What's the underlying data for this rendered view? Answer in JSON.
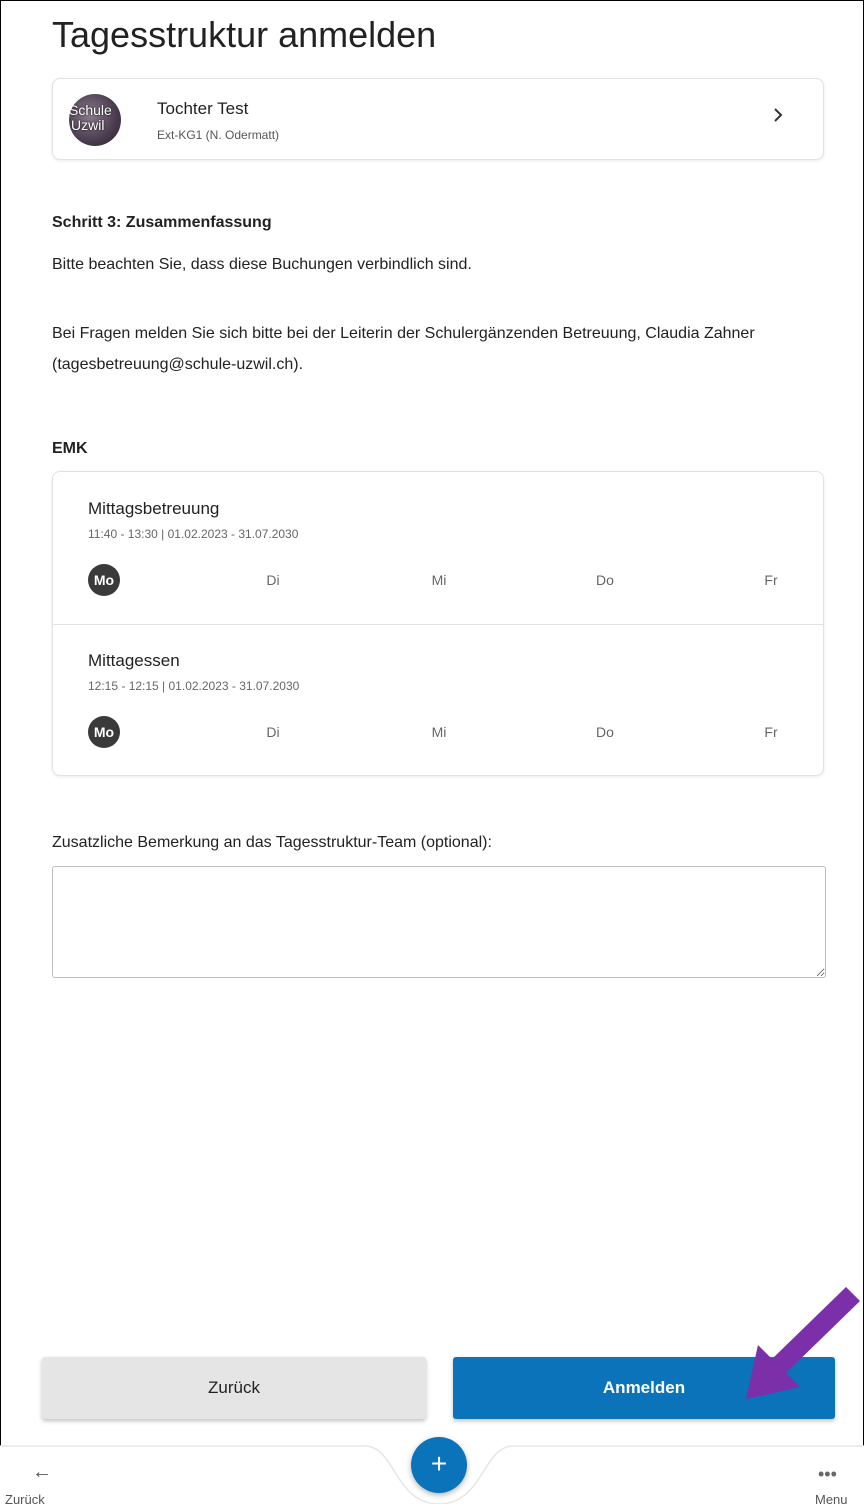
{
  "page": {
    "title": "Tagesstruktur anmelden"
  },
  "child": {
    "avatar_text_line1": "Schule",
    "avatar_text_line2": "Uzwil",
    "name": "Tochter Test",
    "class": "Ext-KG1 (N. Odermatt)"
  },
  "summary": {
    "step_title": "Schritt 3: Zusammenfassung",
    "notice": "Bitte beachten Sie, dass diese Buchungen verbindlich sind.",
    "contact": "Bei Fragen melden Sie sich bitte bei der Leiterin der Schulergänzenden Betreuung, Claudia Zahner (tagesbetreuung@schule-uzwil.ch)."
  },
  "section": {
    "title": "EMK"
  },
  "bookings": [
    {
      "name": "Mittagsbetreuung",
      "meta": "11:40 - 13:30 | 01.02.2023 - 31.07.2030",
      "days": [
        "Mo",
        "Di",
        "Mi",
        "Do",
        "Fr"
      ],
      "selected": [
        "Mo"
      ]
    },
    {
      "name": "Mittagessen",
      "meta": "12:15 - 12:15 | 01.02.2023 - 31.07.2030",
      "days": [
        "Mo",
        "Di",
        "Mi",
        "Do",
        "Fr"
      ],
      "selected": [
        "Mo"
      ]
    }
  ],
  "remark": {
    "label": "Zusatzliche Bemerkung an das Tagesstruktur-Team (optional):",
    "value": "",
    "placeholder": ""
  },
  "actions": {
    "back_label": "Zurück",
    "submit_label": "Anmelden"
  },
  "bottom_nav": {
    "back_icon": "←",
    "back_label": "Zurück",
    "fab_icon": "+",
    "menu_icon": "•••",
    "menu_label": "Menu"
  },
  "colors": {
    "primary": "#0a73ba",
    "selected_day": "#3a3a3a",
    "arrow": "#7b2fa8"
  }
}
